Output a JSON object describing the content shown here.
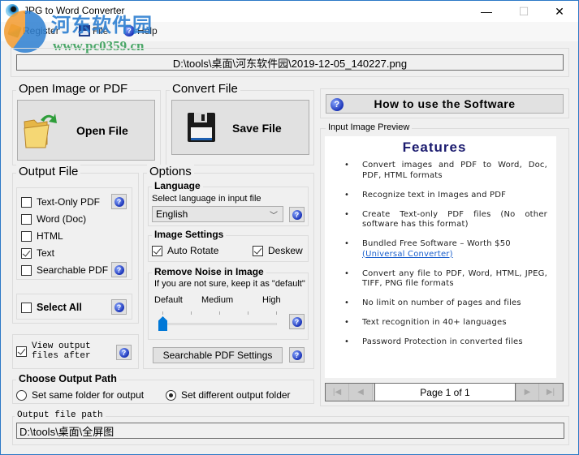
{
  "window": {
    "title": "JPG to Word Converter",
    "controls": {
      "minimize": "—",
      "maximize": "☐",
      "close": "✕"
    }
  },
  "watermark": {
    "text": "河东软件园",
    "url": "www.pc0359.cn"
  },
  "menu": {
    "items": [
      {
        "label": "Register",
        "icon": "key-icon"
      },
      {
        "label": "File",
        "icon": "floppy-disk-icon"
      },
      {
        "label": "Help",
        "icon": "help-icon"
      }
    ]
  },
  "input_path": "D:\\tools\\桌面\\河东软件园\\2019-12-05_140227.png",
  "open_group": {
    "title": "Open Image or PDF",
    "button_label": "Open File"
  },
  "convert_group": {
    "title": "Convert File",
    "button_label": "Save File"
  },
  "output_file": {
    "title": "Output File",
    "formats": [
      {
        "label": "Text-Only PDF",
        "checked": false,
        "help": true
      },
      {
        "label": "Word (Doc)",
        "checked": false,
        "help": false
      },
      {
        "label": "HTML",
        "checked": false,
        "help": false
      },
      {
        "label": "Text",
        "checked": true,
        "help": false
      },
      {
        "label": "Searchable PDF",
        "checked": false,
        "help": true
      }
    ],
    "select_all": {
      "label": "Select All",
      "checked": false
    },
    "view_after": {
      "label_line1": "View output",
      "label_line2": "files after",
      "checked": true
    }
  },
  "options": {
    "title": "Options",
    "language": {
      "title": "Language",
      "hint": "Select language in input file",
      "selected": "English"
    },
    "image_settings": {
      "title": "Image Settings",
      "auto_rotate": {
        "label": "Auto Rotate",
        "checked": true
      },
      "deskew": {
        "label": "Deskew",
        "checked": true
      }
    },
    "noise": {
      "title": "Remove Noise in Image",
      "hint": "If you are not sure, keep it as \"default\"",
      "levels": [
        "Default",
        "Medium",
        "High"
      ],
      "tick_count": 5,
      "value_index": 0
    },
    "searchable_pdf_settings_label": "Searchable PDF Settings"
  },
  "how_to_button": "How to use the Software",
  "preview": {
    "title": "Input Image Preview",
    "heading": "Features",
    "items": [
      {
        "text": "Convert images and PDF to Word, Doc, PDF, HTML formats"
      },
      {
        "text": "Recognize text in Images and PDF"
      },
      {
        "text": "Create Text-only PDF files (No other software has this format)"
      },
      {
        "text": "Bundled Free Software – Worth $50",
        "link": "(Universal Converter)"
      },
      {
        "text": "Convert any file to PDF, Word, HTML, JPEG, TIFF, PNG file formats"
      },
      {
        "text": "No limit on number of pages and files"
      },
      {
        "text": "Text recognition in 40+ languages"
      },
      {
        "text": "Password Protection in converted files"
      }
    ],
    "pager": {
      "label": "Page 1 of 1",
      "first": "|◀",
      "prev": "◀",
      "next": "▶",
      "last": "▶|"
    }
  },
  "output_path": {
    "title": "Choose Output Path",
    "same_folder": {
      "label": "Set same folder for output",
      "selected": false
    },
    "different_folder": {
      "label": "Set different output folder",
      "selected": true
    },
    "field_title": "Output file path",
    "value": "D:\\tools\\桌面\\全屏图"
  }
}
